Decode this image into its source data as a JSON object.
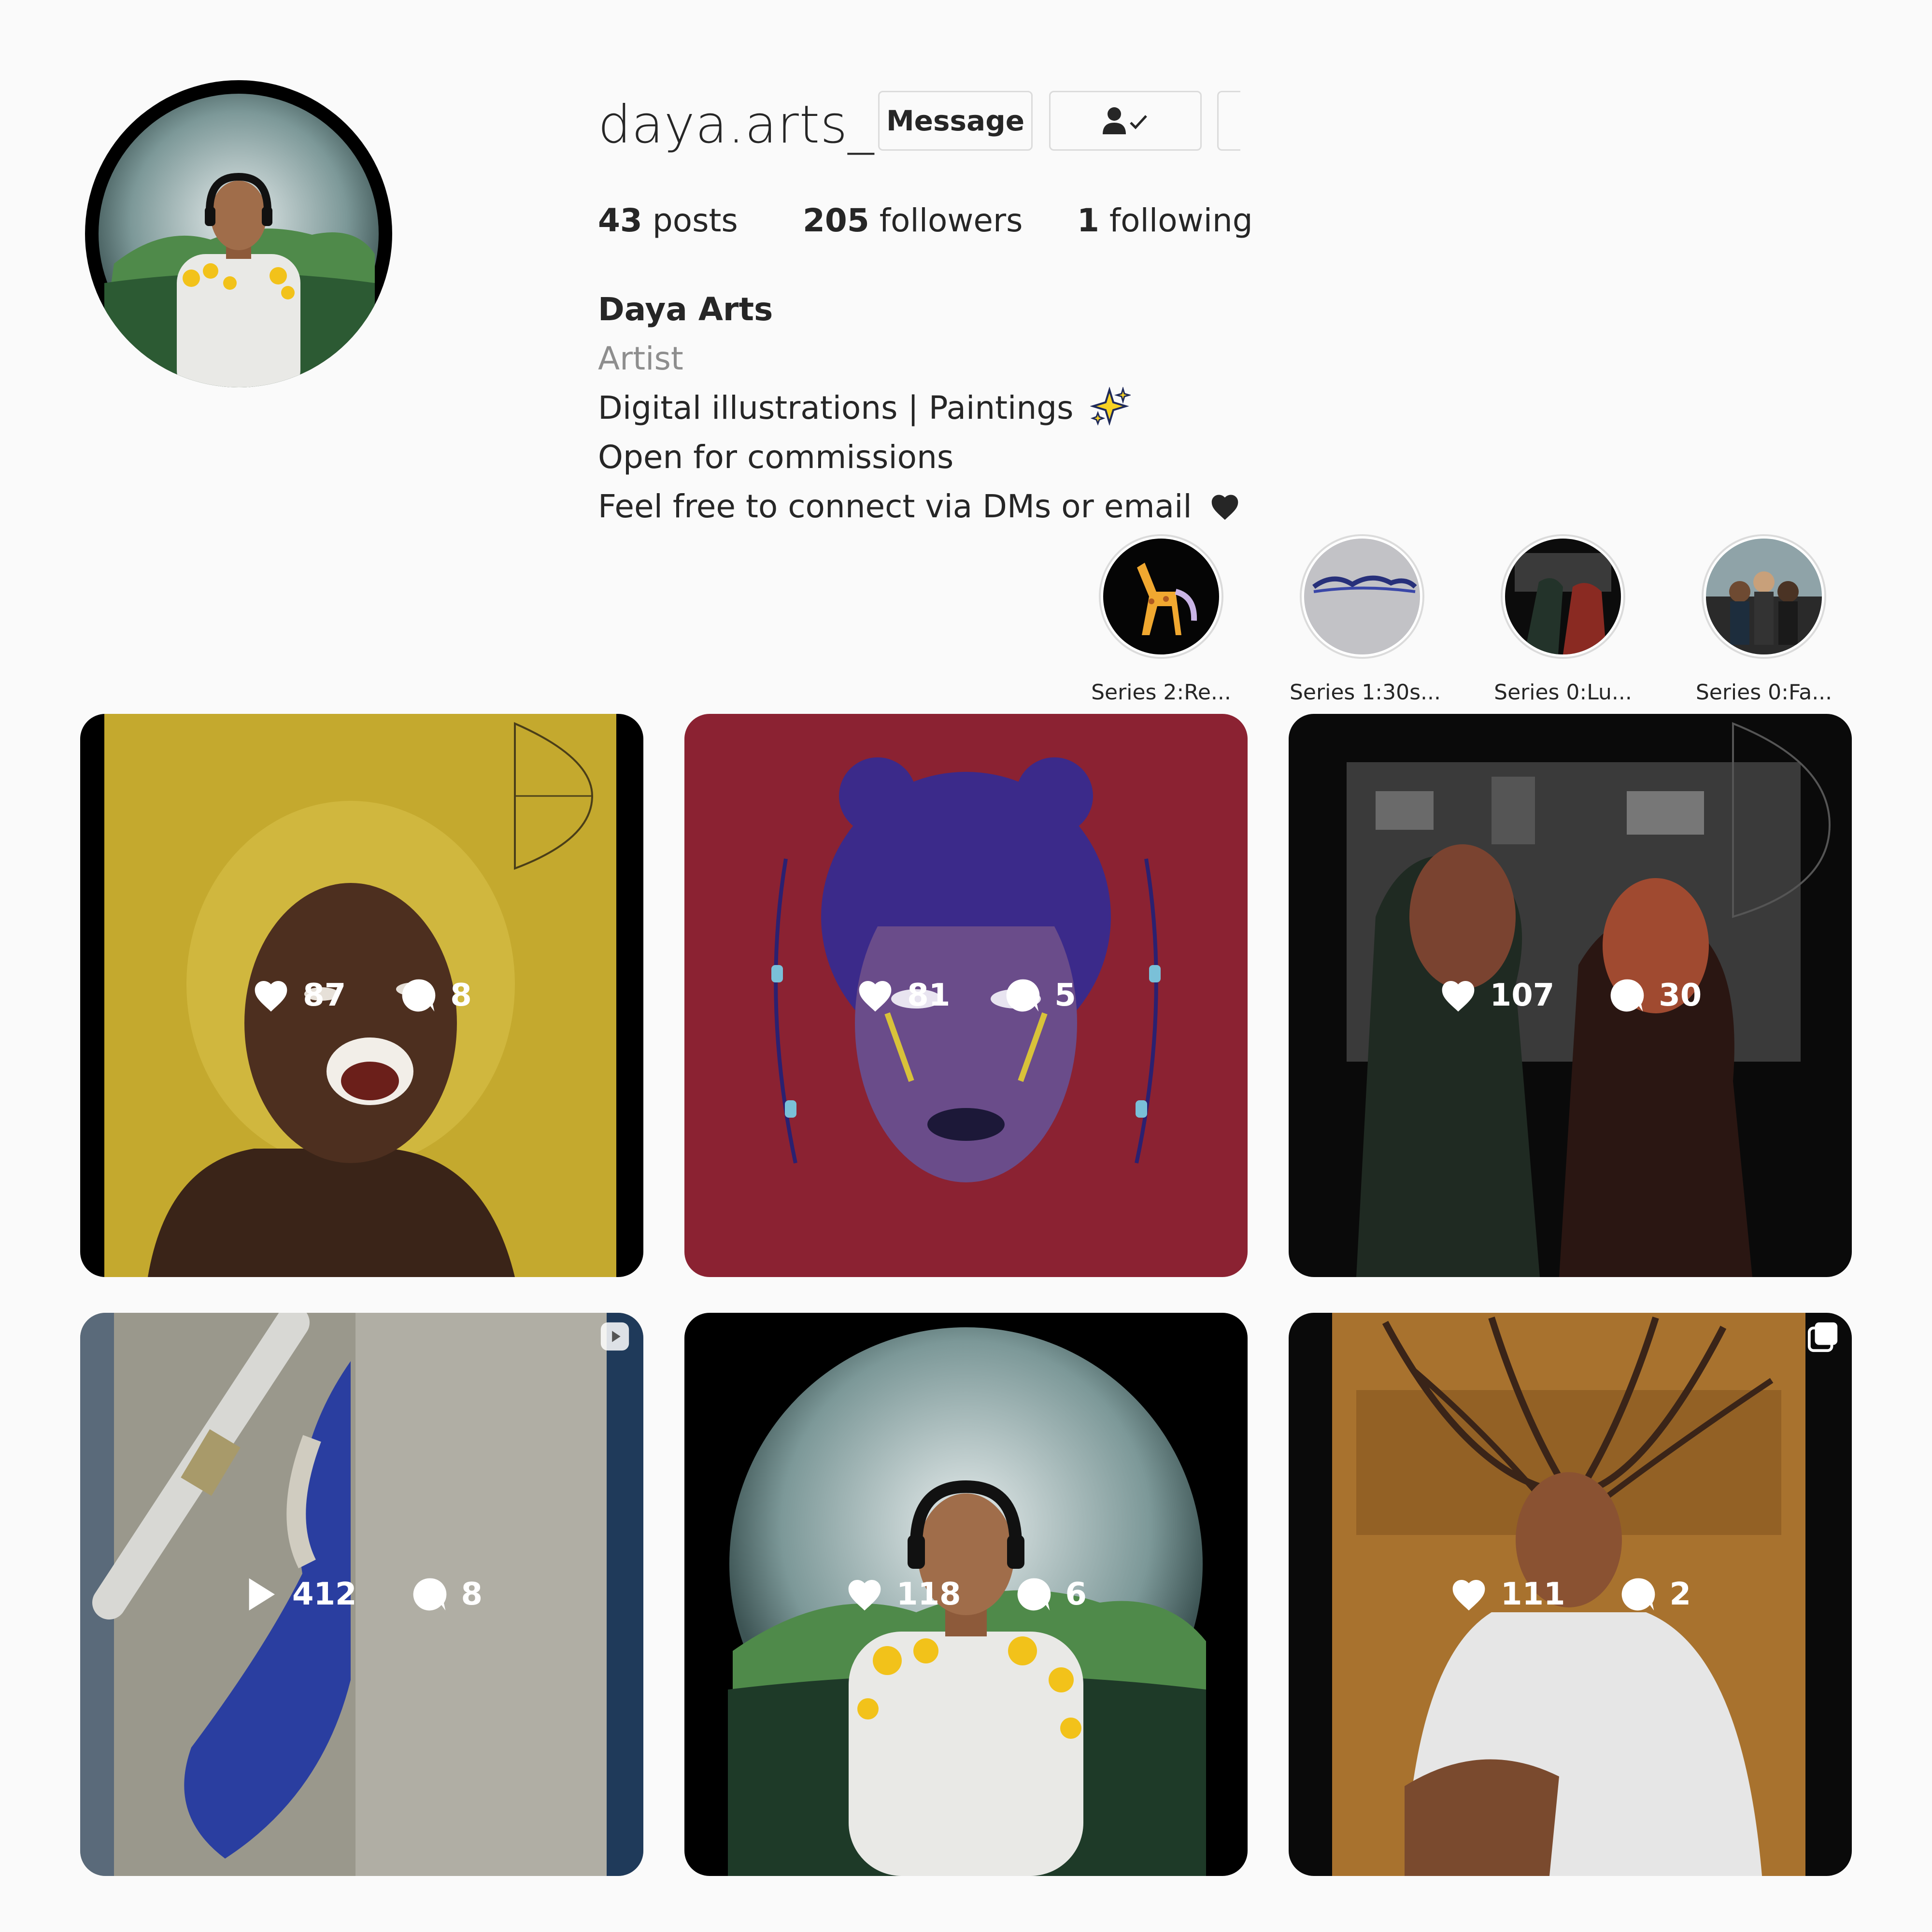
{
  "profile": {
    "username": "daya.arts_",
    "message_label": "Message",
    "posts_count": "43",
    "posts_label": "posts",
    "followers_count": "205",
    "followers_label": "followers",
    "following_count": "1",
    "following_label": "following",
    "display_name": "Daya Arts",
    "category": "Artist",
    "bio_lines": [
      "Digital illustrations | Paintings",
      "Open for commissions",
      "Feel free to connect via DMs or email"
    ]
  },
  "highlights": [
    {
      "label": "Series 2:Re..."
    },
    {
      "label": "Series 1:30s..."
    },
    {
      "label": "Series 0:Lu..."
    },
    {
      "label": "Series 0:Fa..."
    }
  ],
  "posts": [
    {
      "type": "image",
      "likes": "87",
      "comments": "8",
      "bg": "#c4a92e"
    },
    {
      "type": "image",
      "likes": "81",
      "comments": "5",
      "bg": "#8b2232"
    },
    {
      "type": "image",
      "likes": "107",
      "comments": "30",
      "bg": "#0a0a0a"
    },
    {
      "type": "reel",
      "views": "412",
      "comments": "8",
      "bg": "#9a988c"
    },
    {
      "type": "image",
      "likes": "118",
      "comments": "6",
      "bg": "#000000"
    },
    {
      "type": "carousel",
      "likes": "111",
      "comments": "2",
      "bg": "#a8722e"
    }
  ],
  "colors": {
    "text": "#262626",
    "muted": "#8e8e8e",
    "border": "#dbdbdb",
    "background": "#fafafa"
  }
}
